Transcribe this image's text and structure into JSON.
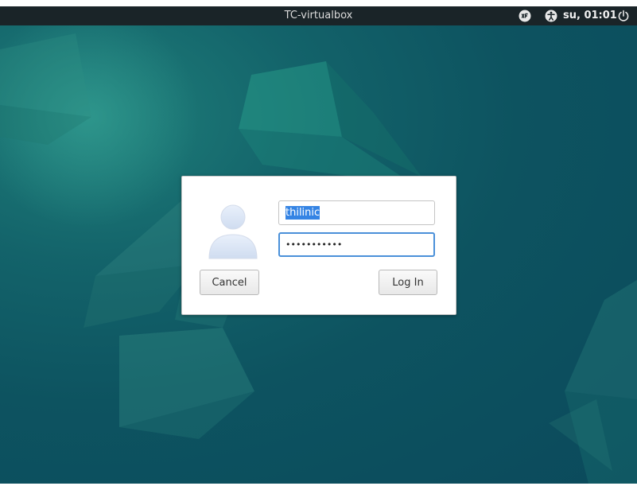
{
  "topbar": {
    "hostname": "TC-virtualbox",
    "clock": "su, 01:01",
    "keyboard_indicator_icon": "keyboard-layout-icon",
    "accessibility_icon": "accessibility-icon",
    "power_icon": "power-icon"
  },
  "login_dialog": {
    "avatar_icon": "user-avatar-icon",
    "username_value": "thilinic",
    "password_value": "•••••••••••",
    "cancel_label": "Cancel",
    "login_label": "Log In",
    "accent_color": "#3584e4"
  },
  "desktop": {
    "wallpaper_colors": [
      "#0b4a5c",
      "#13636a",
      "#1f7f7a"
    ]
  }
}
